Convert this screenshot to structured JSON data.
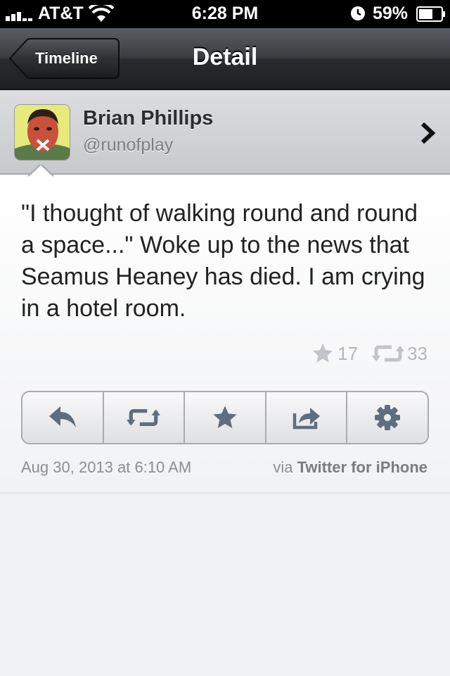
{
  "status_bar": {
    "carrier": "AT&T",
    "time": "6:28 PM",
    "battery": "59%"
  },
  "nav": {
    "back_label": "Timeline",
    "title": "Detail"
  },
  "user": {
    "name": "Brian Phillips",
    "handle": "@runofplay"
  },
  "tweet": {
    "text": "\"I thought of walking round and round a space...\" Woke up to the news that Seamus Heaney has died. I am crying in a hotel room.",
    "favorites": "17",
    "retweets": "33",
    "date": "Aug 30, 2013 at 6:10 AM",
    "via_prefix": "via",
    "via_source": "Twitter for iPhone"
  },
  "actions": [
    {
      "icon": "reply-icon"
    },
    {
      "icon": "retweet-icon"
    },
    {
      "icon": "star-icon"
    },
    {
      "icon": "share-icon"
    },
    {
      "icon": "gear-icon"
    }
  ]
}
